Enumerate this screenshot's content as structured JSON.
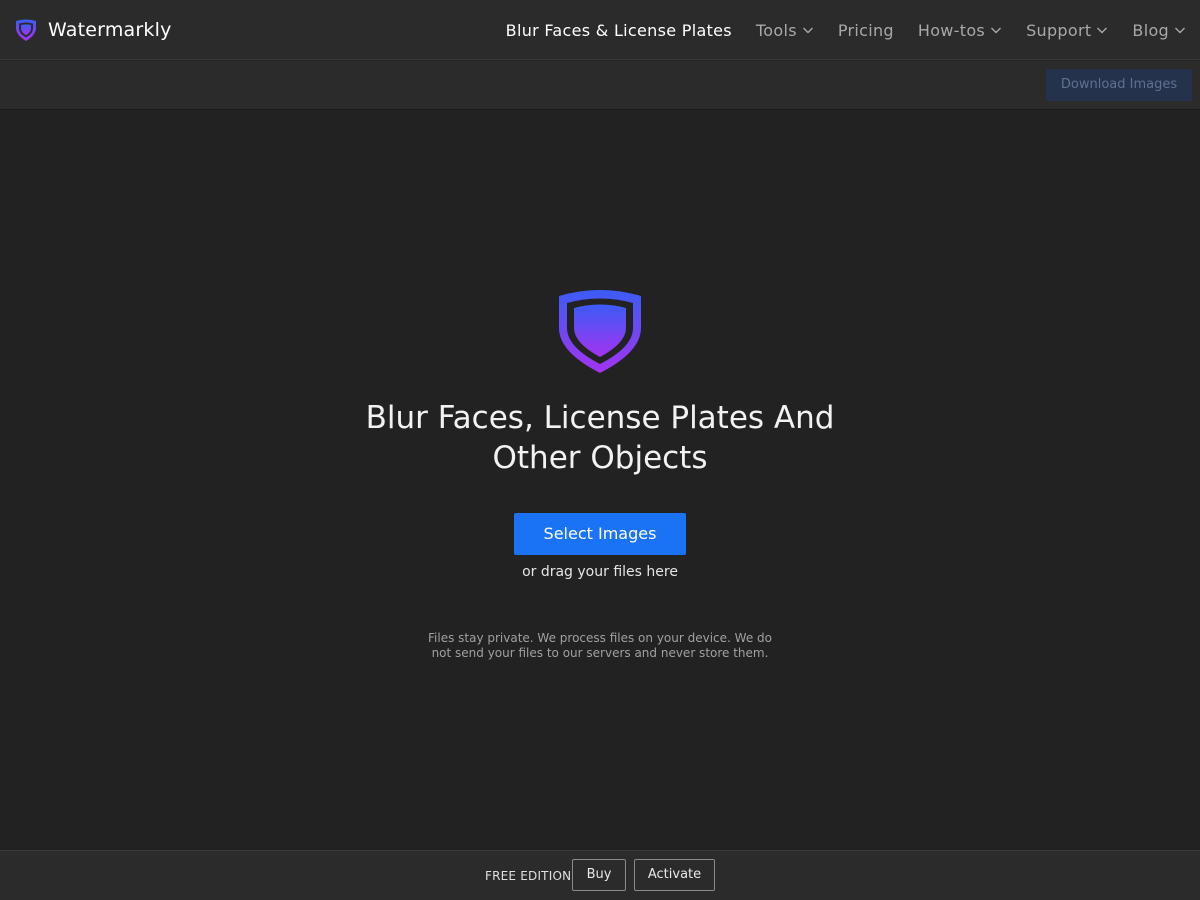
{
  "brand": {
    "name": "Watermarkly",
    "icon": "shield-logo-icon",
    "gradient_top": "#3b5cf6",
    "gradient_bottom": "#a433f0"
  },
  "nav": {
    "items": [
      {
        "label": "Blur Faces & License Plates",
        "active": true,
        "dropdown": false
      },
      {
        "label": "Tools",
        "active": false,
        "dropdown": true
      },
      {
        "label": "Pricing",
        "active": false,
        "dropdown": false
      },
      {
        "label": "How-tos",
        "active": false,
        "dropdown": true
      },
      {
        "label": "Support",
        "active": false,
        "dropdown": true
      },
      {
        "label": "Blog",
        "active": false,
        "dropdown": true
      }
    ]
  },
  "toolbar": {
    "download_label": "Download Images"
  },
  "hero": {
    "title": "Blur Faces, License Plates And Other Objects",
    "select_label": "Select Images",
    "drag_hint": "or drag your files here",
    "privacy_note": "Files stay private. We process files on your device. We do not send your files to our servers and never store them."
  },
  "footer": {
    "edition": "FREE EDITION",
    "buy_label": "Buy",
    "activate_label": "Activate"
  },
  "colors": {
    "background": "#222222",
    "bar": "#2b2b2b",
    "primary": "#1a73f5",
    "disabled_button": "#24324c"
  }
}
